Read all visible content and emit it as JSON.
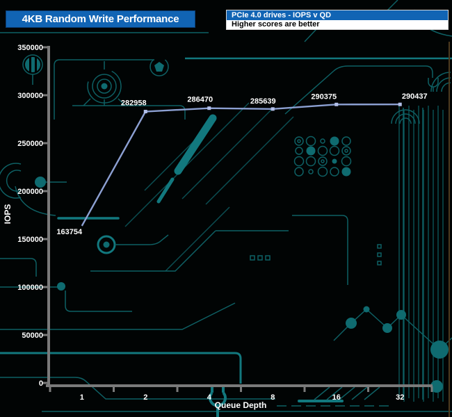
{
  "header": {
    "title": "4KB Random Write Performance",
    "subtitle": "PCIe 4.0 drives - IOPS v QD",
    "note": "Higher scores are better"
  },
  "chart_data": {
    "type": "line",
    "title": "4KB Random Write Performance",
    "subtitle": "PCIe 4.0 drives - IOPS v QD",
    "note": "Higher scores are better",
    "categories": [
      "1",
      "2",
      "4",
      "8",
      "16",
      "32"
    ],
    "values": [
      163754,
      282958,
      286470,
      285639,
      290375,
      290437
    ],
    "xlabel": "Queue Depth",
    "ylabel": "IOPS",
    "ylim": [
      0,
      350000
    ],
    "ytick_step": 50000,
    "ytick_labels": [
      "0",
      "50000",
      "100000",
      "150000",
      "200000",
      "250000",
      "300000",
      "350000"
    ],
    "grid": false,
    "legend": "none",
    "line_color": "#8ca0d2",
    "marker_color": "#b2bfe9",
    "data_label_color": "#ffffff"
  },
  "colors": {
    "background": "#010404",
    "header_bg": "#1164b4",
    "header_text": "#ffffff",
    "note_bg": "#ffffff",
    "note_text": "#000000",
    "axis_gray": "#7a7a7a",
    "circuit_teal": "#0e6064",
    "circuit_bright": "#12787e"
  }
}
